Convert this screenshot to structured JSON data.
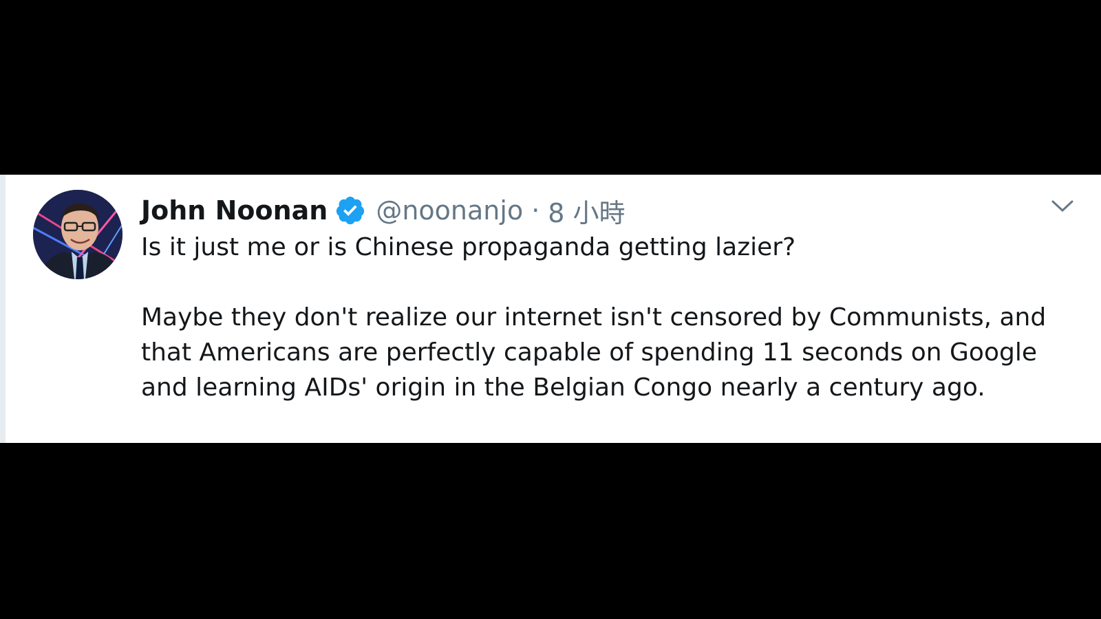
{
  "tweet": {
    "author": {
      "display_name": "John Noonan",
      "handle": "@noonanjo",
      "verified": true,
      "avatar_icon": "user-avatar-icon"
    },
    "separator": "·",
    "timestamp": "8 小時",
    "paragraphs": [
      "Is it just me or is Chinese propaganda getting lazier?",
      "Maybe they don't realize our internet isn't censored by Communists, and that Americans are perfectly capable of spending 11 seconds on Google and learning AIDs' origin in the Belgian Congo nearly a century ago."
    ],
    "menu_icon": "chevron-down-icon"
  },
  "colors": {
    "background": "#000000",
    "card": "#ffffff",
    "text_primary": "#14171a",
    "text_secondary": "#657786",
    "verified_blue": "#1da1f2"
  }
}
